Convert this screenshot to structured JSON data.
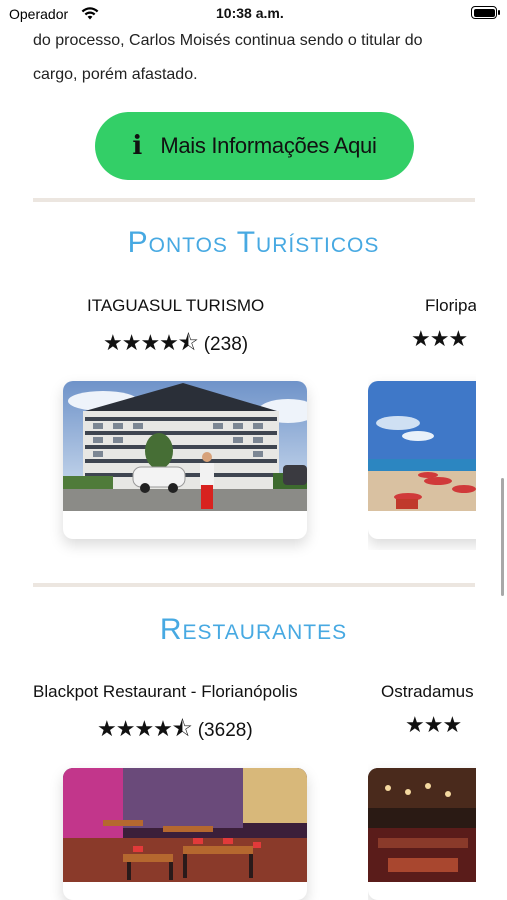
{
  "status_bar": {
    "carrier": "Operador",
    "time": "10:38 a.m."
  },
  "article": {
    "lines": [
      "do processo, Carlos Moisés continua sendo o titular do",
      "cargo, porém afastado."
    ]
  },
  "info_button": {
    "icon": "i",
    "label": "Mais Informações Aqui",
    "color": "#33cf67"
  },
  "tourist_section": {
    "title": "Pontos Turísticos",
    "title_color": "#47a9e2",
    "cards": [
      {
        "name": "ITAGUASUL TURISMO",
        "stars": "★★★★⯪",
        "rating": 4.5,
        "count": "(238)",
        "image": "hotel-building-photo"
      },
      {
        "name": "Floripa",
        "stars": "★★★",
        "image": "beach-photo"
      }
    ]
  },
  "restaurant_section": {
    "title": "Restaurantes",
    "cards": [
      {
        "name": "Blackpot Restaurant - Florianópolis",
        "stars": "★★★★⯪",
        "rating": 4.5,
        "count": "(3628)",
        "image": "restaurant-interior-photo"
      },
      {
        "name": "Ostradamus",
        "stars": "★★★",
        "image": "restaurant-bar-photo"
      }
    ]
  }
}
